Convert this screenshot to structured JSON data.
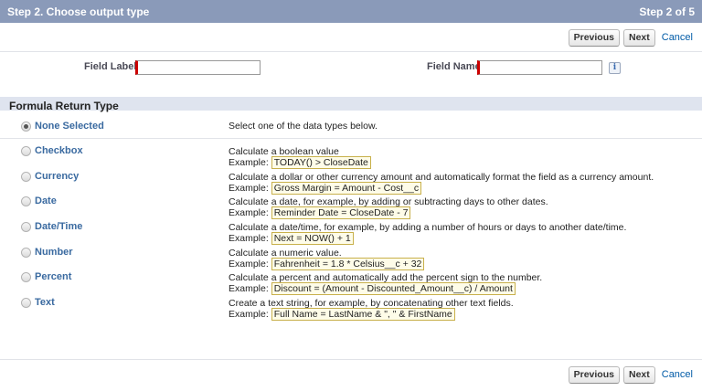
{
  "header": {
    "title": "Step 2. Choose output type",
    "step": "Step 2 of 5"
  },
  "buttons": {
    "previous": "Previous",
    "next": "Next",
    "cancel": "Cancel"
  },
  "fields": {
    "field_label": "Field Label",
    "field_name": "Field Name",
    "field_label_value": "",
    "field_name_value": "",
    "info_icon": "i"
  },
  "section": {
    "title": "Formula Return Type"
  },
  "return_types": [
    {
      "label": "None Selected",
      "selected": true,
      "description": "Select one of the data types below.",
      "example_prefix": "",
      "example": ""
    },
    {
      "label": "Checkbox",
      "selected": false,
      "description": "Calculate a boolean value",
      "example_prefix": "Example:",
      "example": "TODAY() > CloseDate"
    },
    {
      "label": "Currency",
      "selected": false,
      "description": "Calculate a dollar or other currency amount and automatically format the field as a currency amount.",
      "example_prefix": "Example:",
      "example": "Gross Margin = Amount - Cost__c"
    },
    {
      "label": "Date",
      "selected": false,
      "description": "Calculate a date, for example, by adding or subtracting days to other dates.",
      "example_prefix": "Example:",
      "example": "Reminder Date = CloseDate - 7"
    },
    {
      "label": "Date/Time",
      "selected": false,
      "description": "Calculate a date/time, for example, by adding a number of hours or days to another date/time.",
      "example_prefix": "Example:",
      "example": "Next = NOW() + 1"
    },
    {
      "label": "Number",
      "selected": false,
      "description": "Calculate a numeric value.",
      "example_prefix": "Example:",
      "example": "Fahrenheit = 1.8 * Celsius__c + 32"
    },
    {
      "label": "Percent",
      "selected": false,
      "description": "Calculate a percent and automatically add the percent sign to the number.",
      "example_prefix": "Example:",
      "example": "Discount = (Amount - Discounted_Amount__c) / Amount"
    },
    {
      "label": "Text",
      "selected": false,
      "description": "Create a text string, for example, by concatenating other text fields.",
      "example_prefix": "Example:",
      "example": "Full Name = LastName & \", \" & FirstName"
    }
  ]
}
